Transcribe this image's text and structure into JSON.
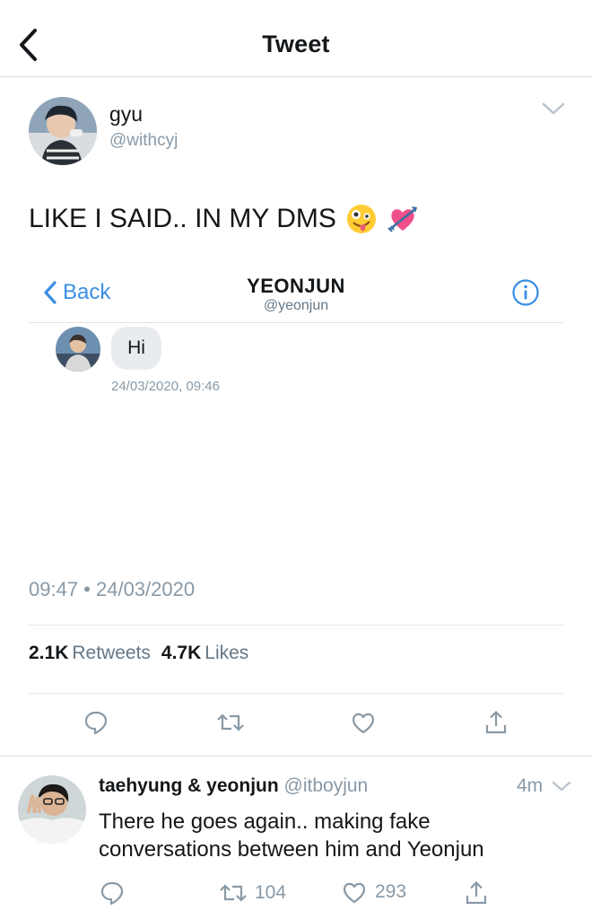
{
  "header": {
    "title": "Tweet"
  },
  "tweet": {
    "author_name": "gyu",
    "author_handle": "@withcyj",
    "text": "LIKE I SAID.. IN MY DMS",
    "emojis": [
      "zany-face",
      "heart-with-arrow"
    ],
    "dm_screenshot": {
      "back_label": "Back",
      "contact_name": "YEONJUN",
      "contact_handle": "@yeonjun",
      "message": "Hi",
      "message_time": "24/03/2020, 09:46"
    },
    "time": "09:47 • 24/03/2020",
    "retweets_count": "2.1K",
    "retweets_label": "Retweets",
    "likes_count": "4.7K",
    "likes_label": "Likes",
    "action_icons": [
      "reply-icon",
      "retweet-icon",
      "like-icon",
      "share-icon"
    ]
  },
  "reply": {
    "name": "taehyung & yeonjun",
    "handle": "@itboyjun",
    "time": "4m",
    "text": "There he goes again.. making fake conversations between him and Yeonjun",
    "retweets": "104",
    "likes": "293"
  },
  "colors": {
    "link_blue": "#3a8ee6",
    "muted": "#8899a6",
    "bubble": "#e9ecef"
  }
}
